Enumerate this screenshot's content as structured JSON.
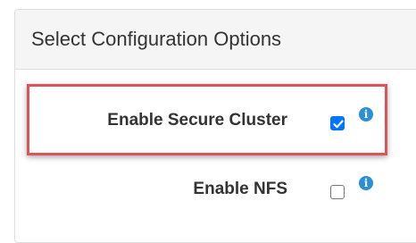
{
  "panel": {
    "title": "Select Configuration Options"
  },
  "options": [
    {
      "label": "Enable Secure Cluster",
      "checked": true,
      "highlighted": true,
      "info_icon": "info-icon"
    },
    {
      "label": "Enable NFS",
      "checked": false,
      "highlighted": false,
      "info_icon": "info-icon"
    }
  ],
  "colors": {
    "highlight_border": "#e05259",
    "checkbox_checked": "#0075ff",
    "info_icon": "#2a8fd6",
    "header_bg": "#f5f5f5",
    "text": "#333333"
  }
}
